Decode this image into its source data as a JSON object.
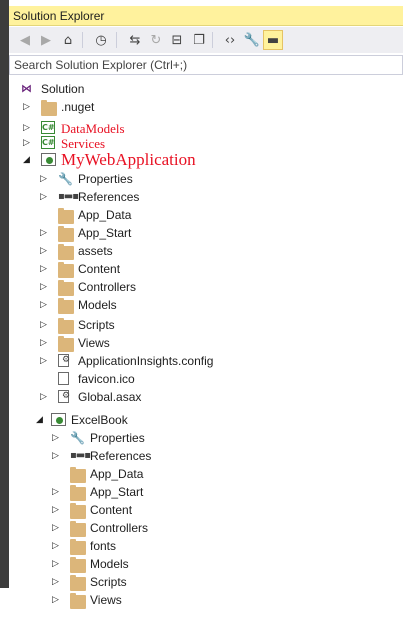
{
  "window": {
    "title": "Solution Explorer"
  },
  "toolbar": {
    "buttons": [
      {
        "name": "back-button",
        "icon": "back-arrow-icon",
        "glyph": "◀",
        "disabled": true
      },
      {
        "name": "forward-button",
        "icon": "forward-arrow-icon",
        "glyph": "▶",
        "disabled": true
      },
      {
        "name": "home-button",
        "icon": "home-icon",
        "glyph": "⌂",
        "disabled": false
      },
      {
        "name": "pending-changes-button",
        "icon": "clock-icon",
        "glyph": "◷",
        "disabled": false
      },
      {
        "name": "sync-button",
        "icon": "sync-icon",
        "glyph": "⇆",
        "disabled": false
      },
      {
        "name": "refresh-button",
        "icon": "refresh-icon",
        "glyph": "↻",
        "disabled": true
      },
      {
        "name": "collapse-all-button",
        "icon": "collapse-all-icon",
        "glyph": "⊟",
        "disabled": false
      },
      {
        "name": "show-all-files-button",
        "icon": "copy-files-icon",
        "glyph": "❐",
        "disabled": false
      },
      {
        "name": "view-code-button",
        "icon": "code-icon",
        "glyph": "‹›",
        "disabled": false
      },
      {
        "name": "properties-button",
        "icon": "wrench-icon",
        "glyph": "🔧",
        "disabled": false
      },
      {
        "name": "preview-button",
        "icon": "preview-icon",
        "glyph": "▬",
        "disabled": false,
        "active": true
      }
    ]
  },
  "search": {
    "placeholder": "Search Solution Explorer (Ctrl+;)"
  },
  "tree": [
    {
      "label": "Solution",
      "icon": "solution-icon",
      "arrow": "",
      "indent": 0,
      "style": ""
    },
    {
      "label": ".nuget",
      "icon": "folder-icon",
      "arrow": "▷",
      "indent": 1,
      "style": ""
    },
    {
      "label": "DataModels",
      "icon": "csharp-project-icon",
      "arrow": "▷",
      "indent": 1,
      "style": "red"
    },
    {
      "label": "Services",
      "icon": "csharp-project-icon",
      "arrow": "▷",
      "indent": 1,
      "style": "red"
    },
    {
      "label": "MyWebApplication",
      "icon": "web-project-icon",
      "arrow": "◢",
      "indent": 1,
      "style": "red big"
    },
    {
      "label": "Properties",
      "icon": "wrench-icon",
      "arrow": "▷",
      "indent": 2,
      "style": ""
    },
    {
      "label": "References",
      "icon": "references-icon",
      "arrow": "▷",
      "indent": 2,
      "style": ""
    },
    {
      "label": "App_Data",
      "icon": "folder-icon",
      "arrow": "",
      "indent": 2,
      "style": ""
    },
    {
      "label": "App_Start",
      "icon": "folder-icon",
      "arrow": "▷",
      "indent": 2,
      "style": ""
    },
    {
      "label": "assets",
      "icon": "folder-icon",
      "arrow": "▷",
      "indent": 2,
      "style": ""
    },
    {
      "label": "Content",
      "icon": "folder-icon",
      "arrow": "▷",
      "indent": 2,
      "style": ""
    },
    {
      "label": "Controllers",
      "icon": "folder-icon",
      "arrow": "▷",
      "indent": 2,
      "style": ""
    },
    {
      "label": "Models",
      "icon": "folder-icon",
      "arrow": "▷",
      "indent": 2,
      "style": ""
    },
    {
      "label": "Scripts",
      "icon": "folder-icon",
      "arrow": "▷",
      "indent": 2,
      "style": ""
    },
    {
      "label": "Views",
      "icon": "folder-icon",
      "arrow": "▷",
      "indent": 2,
      "style": ""
    },
    {
      "label": "ApplicationInsights.config",
      "icon": "config-file-icon",
      "arrow": "▷",
      "indent": 2,
      "style": ""
    },
    {
      "label": "favicon.ico",
      "icon": "file-icon",
      "arrow": "",
      "indent": 2,
      "style": ""
    },
    {
      "label": "Global.asax",
      "icon": "global-file-icon",
      "arrow": "▷",
      "indent": 2,
      "style": ""
    },
    {
      "label": "ExcelBook",
      "icon": "web-project-icon",
      "arrow": "◢",
      "indent": 3,
      "style": ""
    },
    {
      "label": "Properties",
      "icon": "wrench-icon",
      "arrow": "▷",
      "indent": 4,
      "style": ""
    },
    {
      "label": "References",
      "icon": "references-icon",
      "arrow": "▷",
      "indent": 4,
      "style": ""
    },
    {
      "label": "App_Data",
      "icon": "folder-icon",
      "arrow": "",
      "indent": 4,
      "style": ""
    },
    {
      "label": "App_Start",
      "icon": "folder-icon",
      "arrow": "▷",
      "indent": 4,
      "style": ""
    },
    {
      "label": "Content",
      "icon": "folder-icon",
      "arrow": "▷",
      "indent": 4,
      "style": ""
    },
    {
      "label": "Controllers",
      "icon": "folder-icon",
      "arrow": "▷",
      "indent": 4,
      "style": ""
    },
    {
      "label": "fonts",
      "icon": "folder-icon",
      "arrow": "▷",
      "indent": 4,
      "style": ""
    },
    {
      "label": "Models",
      "icon": "folder-icon",
      "arrow": "▷",
      "indent": 4,
      "style": ""
    },
    {
      "label": "Scripts",
      "icon": "folder-icon",
      "arrow": "▷",
      "indent": 4,
      "style": ""
    },
    {
      "label": "Views",
      "icon": "folder-icon",
      "arrow": "▷",
      "indent": 4,
      "style": ""
    }
  ],
  "colors": {
    "titlebar": "#fff29d",
    "project_highlight": "#e81123",
    "folder": "#dcb67a"
  }
}
